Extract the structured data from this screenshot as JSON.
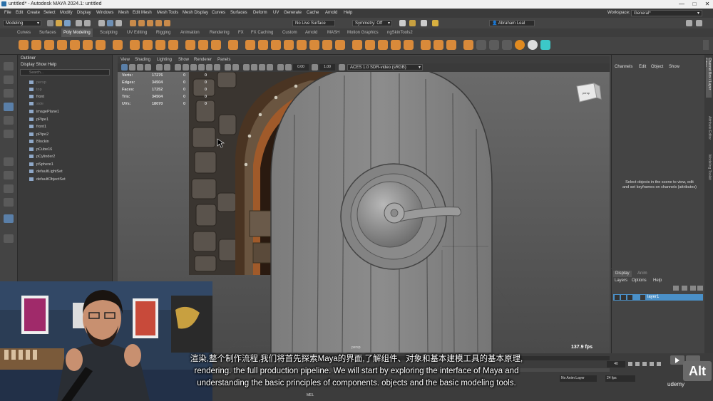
{
  "titlebar": {
    "title": "untitled* - Autodesk MAYA 2024.1: untitled",
    "min": "—",
    "max": "□",
    "close": "✕"
  },
  "menubar": {
    "items": [
      "File",
      "Edit",
      "Create",
      "Select",
      "Modify",
      "Display",
      "Windows",
      "Mesh",
      "Edit Mesh",
      "Mesh Tools",
      "Mesh Display",
      "Curves",
      "Surfaces",
      "Deform",
      "UV",
      "Generate",
      "Cache",
      "Arnold",
      "Help"
    ],
    "workspace_label": "Workspace:",
    "workspace_value": "General*"
  },
  "statusline": {
    "mode": "Modeling",
    "live_surface": "No Live Surface",
    "symmetry": "Symmetry: Off",
    "user": "Abraham Leal"
  },
  "shelftabs": [
    "Curves",
    "Surfaces",
    "Poly Modeling",
    "Sculpting",
    "UV Editing",
    "Rigging",
    "Animation",
    "Rendering",
    "FX",
    "FX Caching",
    "Custom",
    "Arnold",
    "MASH",
    "Motion Graphics",
    "ngSkinTools2"
  ],
  "shelftab_active": "Poly Modeling",
  "outliner": {
    "title": "Outliner",
    "menus": "Display   Show   Help",
    "search_placeholder": "Search...",
    "items": [
      {
        "label": "persp",
        "dim": true
      },
      {
        "label": "top",
        "dim": true
      },
      {
        "label": "front",
        "dim": false
      },
      {
        "label": "side",
        "dim": true
      },
      {
        "label": "imagePlane1",
        "dim": false
      },
      {
        "label": "pPipe1",
        "dim": false
      },
      {
        "label": "front1",
        "dim": false
      },
      {
        "label": "pPipe2",
        "dim": false
      },
      {
        "label": "Blockin",
        "dim": false
      },
      {
        "label": "pCube16",
        "dim": false
      },
      {
        "label": "pCylinder2",
        "dim": false
      },
      {
        "label": "pSphere1",
        "dim": false
      },
      {
        "label": "defaultLightSet",
        "dim": false
      },
      {
        "label": "defaultObjectSet",
        "dim": false
      }
    ]
  },
  "viewport": {
    "menus": [
      "View",
      "Shading",
      "Lighting",
      "Show",
      "Renderer",
      "Panels"
    ],
    "exposure": "0.00",
    "gamma": "1.00",
    "colorspace": "ACES 1.0 SDR-video (sRGB)",
    "hud": [
      {
        "label": "Verts:",
        "a": "17276",
        "b": "0",
        "c": "0"
      },
      {
        "label": "Edges:",
        "a": "34504",
        "b": "0",
        "c": "0"
      },
      {
        "label": "Faces:",
        "a": "17252",
        "b": "0",
        "c": "0"
      },
      {
        "label": "Tris:",
        "a": "34504",
        "b": "0",
        "c": "0"
      },
      {
        "label": "UVs:",
        "a": "18070",
        "b": "0",
        "c": "0"
      }
    ],
    "camera": "persp",
    "fps": "137.9 fps",
    "cube_label": "persp"
  },
  "channelbox": {
    "menus": [
      "Channels",
      "Edit",
      "Object",
      "Show"
    ],
    "message": "Select objects in the scene to view, edit and set keyframes on channels (attributes)"
  },
  "rightstrip": [
    "Channel Box / Layer Editor",
    "Attribute Editor",
    "Modeling Toolkit"
  ],
  "layers": {
    "tabs": [
      "Display",
      "Anim"
    ],
    "menus": [
      "Layers",
      "Options",
      "Help"
    ],
    "layer_name": "layer1"
  },
  "timeline": {
    "frame": "40",
    "anim_layer": "No Anim Layer",
    "fps": "24 fps",
    "mel": "MEL"
  },
  "subtitles": {
    "line1": "渲染,整个制作流程,我们将首先探索Maya的界面,了解组件、对象和基本建模工具的基本原理,",
    "line2": "rendering. the full production pipeline. We will start by exploring the interface of Maya and",
    "line3": "understanding the basic principles of components. objects and the basic modeling tools."
  },
  "watermark": {
    "alt": "Alt",
    "udemy": "udemy"
  },
  "colors": {
    "accent": "#5a7fa8",
    "bg": "#444444",
    "selected": "#4a90c8"
  }
}
